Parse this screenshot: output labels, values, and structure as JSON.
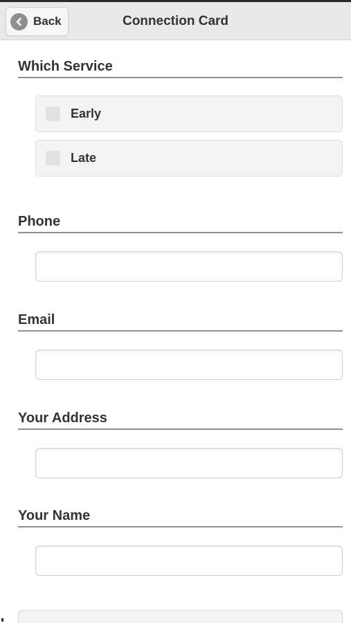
{
  "header": {
    "back_label": "Back",
    "title": "Connection Card"
  },
  "form": {
    "service": {
      "heading": "Which Service",
      "options": [
        {
          "label": "Early",
          "checked": false
        },
        {
          "label": "Late",
          "checked": false
        }
      ]
    },
    "phone": {
      "heading": "Phone",
      "value": ""
    },
    "email": {
      "heading": "Email",
      "value": ""
    },
    "address": {
      "heading": "Your Address",
      "value": ""
    },
    "name": {
      "heading": "Your Name",
      "value": ""
    }
  },
  "colors": {
    "header_bg": "#e9e9e9",
    "text": "#333333",
    "option_bg": "#f4f4f4",
    "divider": "#8f8f8f"
  },
  "icons": {
    "back": "chevron-left-circle-icon"
  }
}
